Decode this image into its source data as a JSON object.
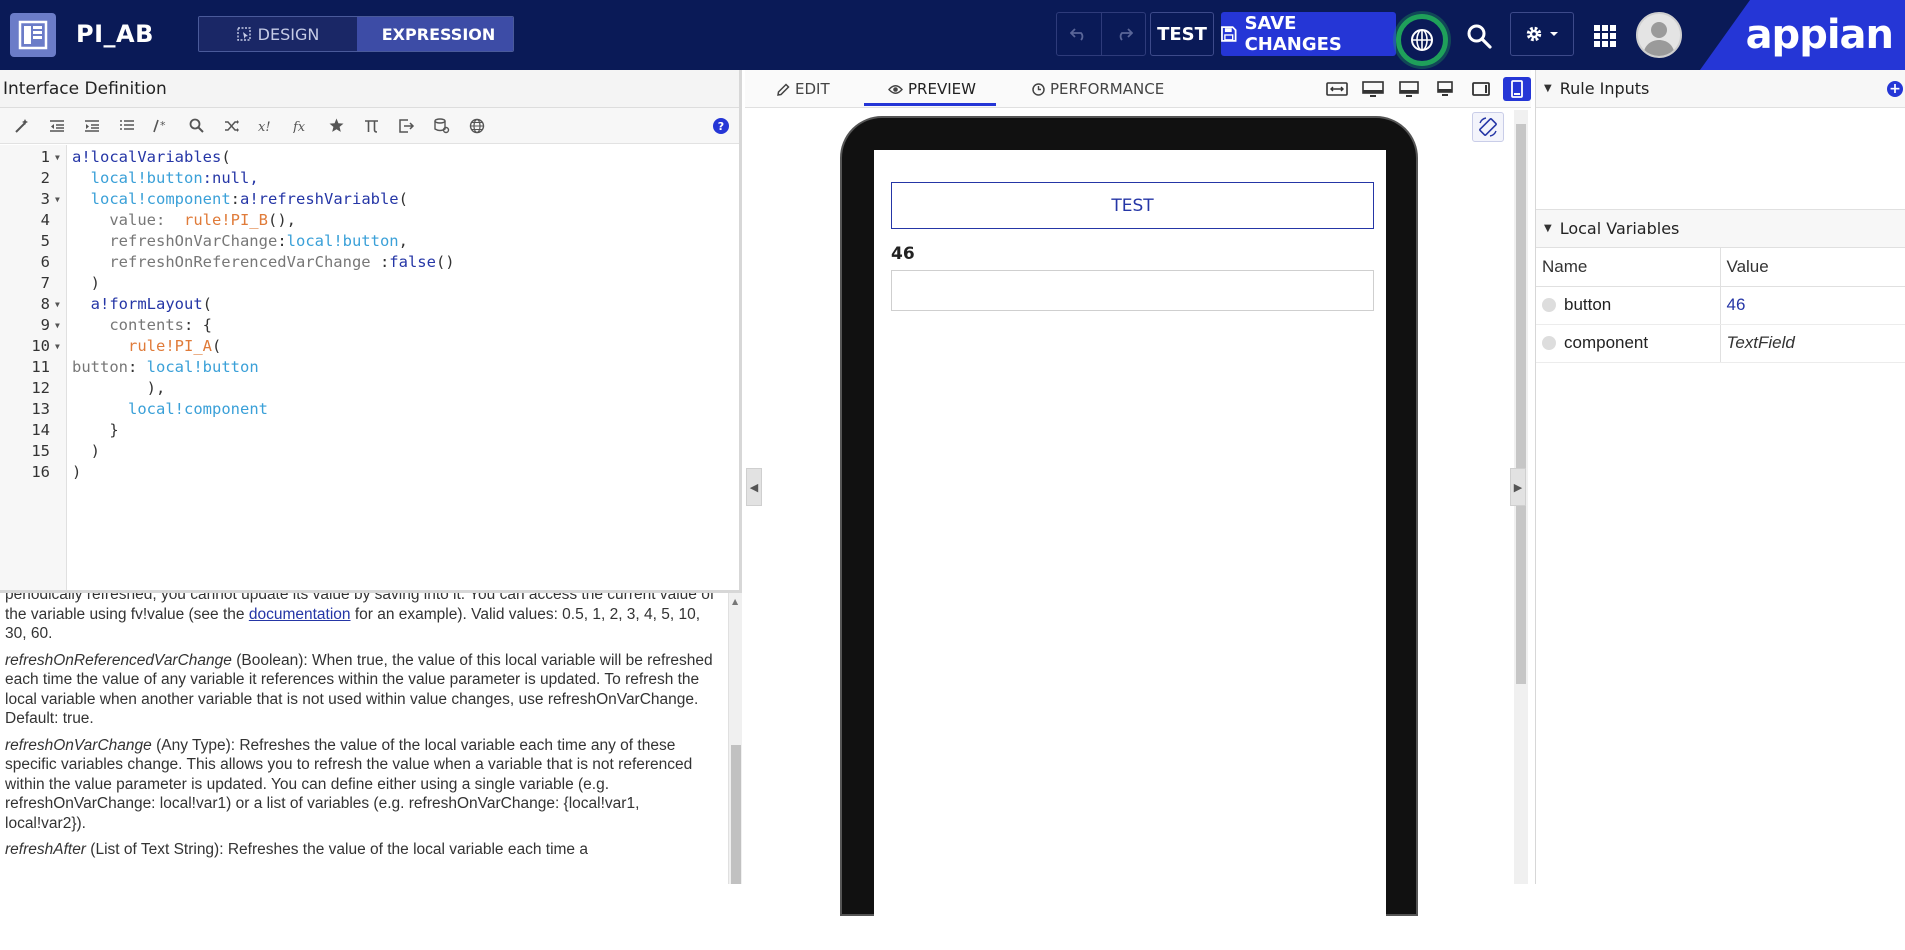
{
  "app": {
    "title": "PI_AB",
    "brand": "appian"
  },
  "mode_toggle": {
    "design_label": "DESIGN",
    "expression_label": "EXPRESSION"
  },
  "actions": {
    "test_label": "TEST",
    "save_label": "SAVE CHANGES"
  },
  "left_panel": {
    "title": "Interface Definition",
    "help_label": "?",
    "toolbar_icons": [
      "magic-wand-icon",
      "outdent-icon",
      "indent-icon",
      "format-icon",
      "comment-icon",
      "search-icon",
      "shuffle-icon",
      "expression-icon",
      "function-icon",
      "star-icon",
      "pi-icon",
      "export-icon",
      "database-icon",
      "globe-icon"
    ],
    "code_lines": [
      {
        "n": "1",
        "fold": true
      },
      {
        "n": "2",
        "fold": false
      },
      {
        "n": "3",
        "fold": true
      },
      {
        "n": "4",
        "fold": false
      },
      {
        "n": "5",
        "fold": false
      },
      {
        "n": "6",
        "fold": false
      },
      {
        "n": "7",
        "fold": false
      },
      {
        "n": "8",
        "fold": true
      },
      {
        "n": "9",
        "fold": true
      },
      {
        "n": "10",
        "fold": true
      },
      {
        "n": "11",
        "fold": false
      },
      {
        "n": "12",
        "fold": false
      },
      {
        "n": "13",
        "fold": false
      },
      {
        "n": "14",
        "fold": false
      },
      {
        "n": "15",
        "fold": false
      },
      {
        "n": "16",
        "fold": false
      }
    ],
    "code": {
      "l1_fn": "a!localVariables",
      "l1_paren": "(",
      "l2_var": "local!button",
      "l2_rest": ":null,",
      "l3_var": "local!component",
      "l3_colon": ":",
      "l3_fn": "a!refreshVariable",
      "l3_paren": "(",
      "l4_param": "value:  ",
      "l4_rule": "rule!PI_B",
      "l4_rest": "(),",
      "l5_param": "refreshOnVarChange",
      "l5_colon": ":",
      "l5_var": "local!button",
      "l5_rest": ",",
      "l6_param": "refreshOnReferencedVarChange ",
      "l6_colon": ":",
      "l6_bool": "false",
      "l6_rest": "()",
      "l7": ")",
      "l8_fn": "a!formLayout",
      "l8_paren": "(",
      "l9_param": "contents",
      "l9_rest": ": {",
      "l10_rule": "rule!PI_A",
      "l10_paren": "(",
      "l11_param": "button",
      "l11_colon": ": ",
      "l11_var": "local!button",
      "l12": "),",
      "l13_var": "local!component",
      "l14": "}",
      "l15": ")",
      "l16": ")"
    },
    "doc": {
      "p1_a": "periodically refreshed, you cannot update its value by saving into it. You can access the current value of the variable using fv!value (see the ",
      "p1_link": "documentation",
      "p1_b": " for an example). Valid values: 0.5, 1, 2, 3, 4, 5, 10, 30, 60.",
      "p2_name": "refreshOnReferencedVarChange",
      "p2_text": " (Boolean): When true, the value of this local variable will be refreshed each time the value of any variable it references within the value parameter is updated. To refresh the local variable when another variable that is not used within value changes, use refreshOnVarChange. Default: true.",
      "p3_name": "refreshOnVarChange",
      "p3_text": " (Any Type): Refreshes the value of the local variable each time any of these specific variables change. This allows you to refresh the value when a variable that is not referenced within the value parameter is updated. You can define either using a single variable (e.g. refreshOnVarChange: local!var1) or a list of variables (e.g. refreshOnVarChange: {local!var1, local!var2}).",
      "p4_name": "refreshAfter",
      "p4_text": " (List of Text String): Refreshes the value of the local variable each time a"
    }
  },
  "preview": {
    "tabs": [
      {
        "label": "EDIT",
        "icon": "pencil-icon"
      },
      {
        "label": "PREVIEW",
        "icon": "eye-icon",
        "active": true
      },
      {
        "label": "PERFORMANCE",
        "icon": "clock-icon"
      }
    ],
    "device_icons": [
      "fit-width-icon",
      "desktop-large-icon",
      "desktop-icon",
      "laptop-icon",
      "tablet-icon",
      "phone-icon"
    ],
    "form": {
      "button_label": "TEST",
      "field_label": "46",
      "field_value": ""
    }
  },
  "right_panel": {
    "rule_inputs_title": "Rule Inputs",
    "add_label": "+",
    "local_vars_title": "Local Variables",
    "columns": [
      "Name",
      "Value"
    ],
    "rows": [
      {
        "name": "button",
        "value": "46"
      },
      {
        "name": "component",
        "value": "TextField"
      }
    ]
  },
  "colors": {
    "topbar": "#0a1a57",
    "accent": "#2536d6",
    "code_keyword": "#2536a6",
    "code_variable": "#3aa0d8",
    "code_rule": "#e07b39"
  }
}
